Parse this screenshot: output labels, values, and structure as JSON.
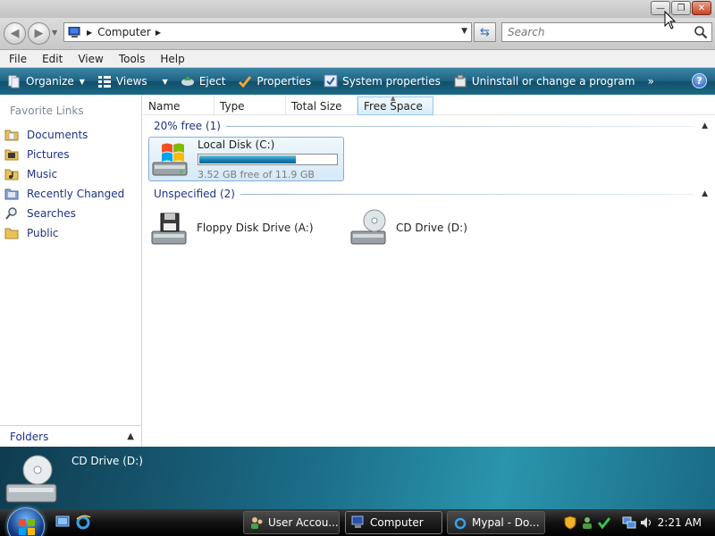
{
  "window": {
    "minimize": "—",
    "restore": "❐",
    "close": "✕"
  },
  "address": {
    "crumb": "Computer",
    "search_placeholder": "Search"
  },
  "menu": [
    "File",
    "Edit",
    "View",
    "Tools",
    "Help"
  ],
  "commands": {
    "organize": "Organize",
    "views": "Views",
    "eject": "Eject",
    "properties": "Properties",
    "system_properties": "System properties",
    "uninstall": "Uninstall or change a program",
    "more": "»",
    "help": "?"
  },
  "nav": {
    "favorites_heading": "Favorite Links",
    "items": [
      "Documents",
      "Pictures",
      "Music",
      "Recently Changed",
      "Searches",
      "Public"
    ],
    "folders": "Folders"
  },
  "columns": [
    "Name",
    "Type",
    "Total Size",
    "Free Space"
  ],
  "groups": {
    "free": {
      "label": "20% free (1)",
      "drive": {
        "name": "Local Disk (C:)",
        "space": "3.52 GB free of 11.9 GB",
        "used_fraction": 0.704
      }
    },
    "unspecified": {
      "label": "Unspecified (2)",
      "floppy": "Floppy Disk Drive (A:)",
      "cd": "CD Drive (D:)"
    }
  },
  "details": {
    "title": "CD Drive (D:)"
  },
  "taskbar": {
    "tasks": [
      "User Accou...",
      "Computer",
      "Mypal - Do..."
    ],
    "clock": "2:21 AM"
  },
  "colors": {
    "accent": "#1f6383",
    "link": "#1e3287"
  }
}
